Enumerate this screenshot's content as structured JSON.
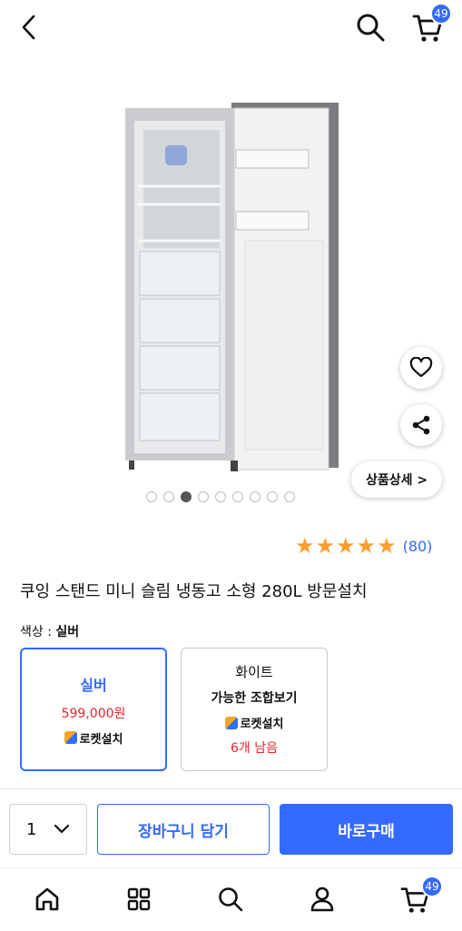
{
  "header": {
    "cart_count": "49"
  },
  "gallery": {
    "detail_button": "상품상세 >",
    "page_count": 9,
    "active_index": 2
  },
  "rating": {
    "stars": 5,
    "count": "(80)"
  },
  "product": {
    "title": "쿠잉 스탠드 미니 슬림 냉동고 소형 280L 방문설치"
  },
  "color": {
    "label": "색상 : ",
    "value": "실버",
    "options": [
      {
        "name": "실버",
        "price": "599,000원",
        "delivery": "로켓설치"
      },
      {
        "name": "화이트",
        "note": "가능한 조합보기",
        "delivery": "로켓설치",
        "stock": "6개 남음"
      }
    ]
  },
  "purchase": {
    "quantity": "1",
    "cart_button": "장바구니 담기",
    "buy_button": "바로구매"
  },
  "nav": {
    "cart_count": "49"
  },
  "colors": {
    "accent": "#346aff",
    "price": "#e52528",
    "star": "#ff9d2f"
  }
}
